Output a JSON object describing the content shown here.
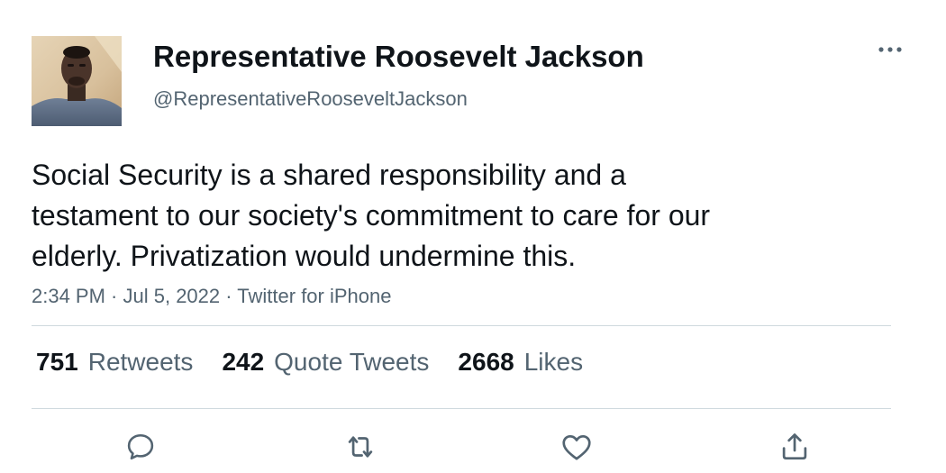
{
  "user": {
    "display_name": "Representative Roosevelt Jackson",
    "handle": "@RepresentativeRooseveltJackson"
  },
  "tweet": {
    "text": "Social Security is a shared responsibility and a\ntestament to our society's commitment to care for our\nelderly. Privatization would undermine this.",
    "time": "2:34 PM",
    "separator": " · ",
    "date": "Jul 5, 2022",
    "source": "Twitter for iPhone"
  },
  "stats": {
    "retweets_count": "751",
    "retweets_label": "Retweets",
    "quotes_count": "242",
    "quotes_label": "Quote Tweets",
    "likes_count": "2668",
    "likes_label": "Likes"
  },
  "icons": {
    "more": "more-icon",
    "reply": "reply-icon",
    "retweet": "retweet-icon",
    "like": "heart-icon",
    "share": "share-icon"
  },
  "colors": {
    "text": "#0f1419",
    "secondary": "#536471",
    "divider": "#cfd9de"
  }
}
